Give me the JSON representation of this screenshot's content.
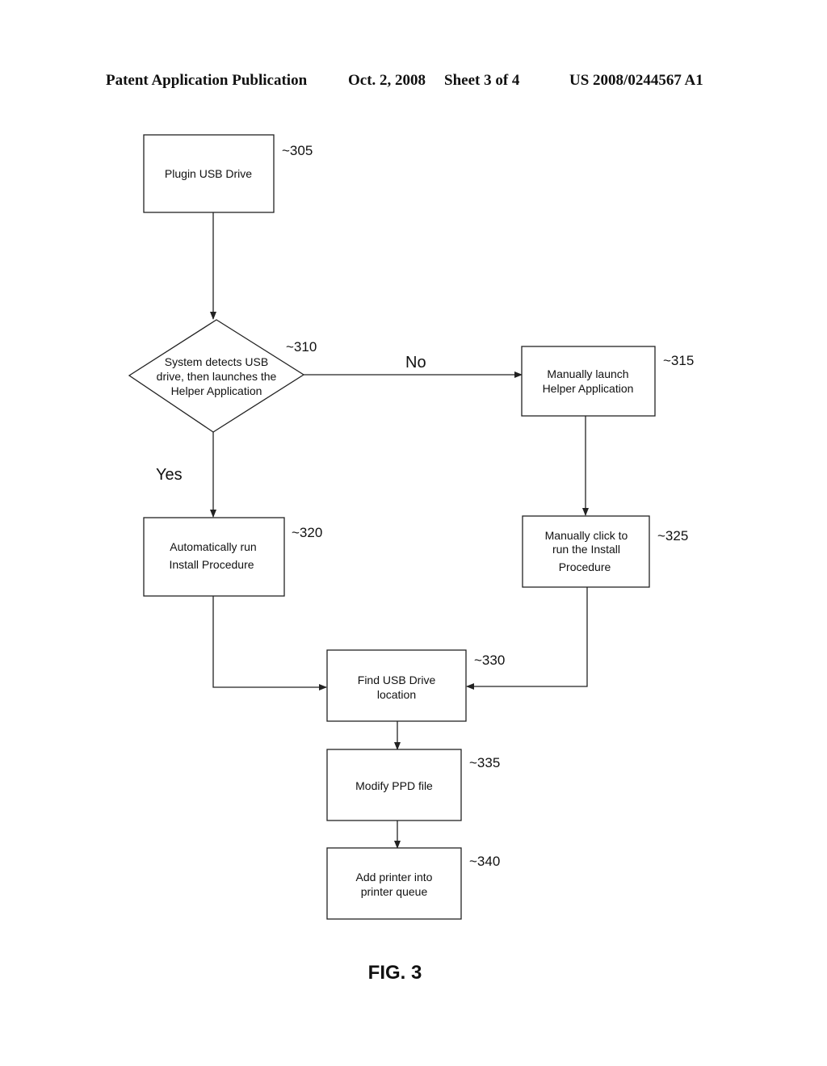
{
  "header": {
    "publication": "Patent Application Publication",
    "date": "Oct. 2, 2008",
    "sheet": "Sheet 3 of 4",
    "number": "US 2008/0244567 A1"
  },
  "nodes": {
    "n305": {
      "ref": "~305",
      "lines": [
        "Plugin USB Drive"
      ]
    },
    "n310": {
      "ref": "~310",
      "lines": [
        "System detects USB",
        "drive, then launches the",
        "Helper Application"
      ]
    },
    "n315": {
      "ref": "~315",
      "lines": [
        "Manually launch",
        "Helper Application"
      ]
    },
    "n320": {
      "ref": "~320",
      "lines": [
        "Automatically run",
        "Install Procedure"
      ]
    },
    "n325": {
      "ref": "~325",
      "lines": [
        "Manually click to",
        "run the Install",
        "Procedure"
      ]
    },
    "n330": {
      "ref": "~330",
      "lines": [
        "Find USB Drive",
        "location"
      ]
    },
    "n335": {
      "ref": "~335",
      "lines": [
        "Modify PPD file"
      ]
    },
    "n340": {
      "ref": "~340",
      "lines": [
        "Add printer into",
        "printer queue"
      ]
    }
  },
  "edges": [
    {
      "from": "305",
      "to": "310",
      "label": ""
    },
    {
      "from": "310",
      "to": "315",
      "label": "No"
    },
    {
      "from": "310",
      "to": "320",
      "label": "Yes"
    },
    {
      "from": "315",
      "to": "325",
      "label": ""
    },
    {
      "from": "320",
      "to": "330",
      "label": ""
    },
    {
      "from": "325",
      "to": "330",
      "label": ""
    },
    {
      "from": "330",
      "to": "335",
      "label": ""
    },
    {
      "from": "335",
      "to": "340",
      "label": ""
    }
  ],
  "figure_label": "FIG. 3"
}
